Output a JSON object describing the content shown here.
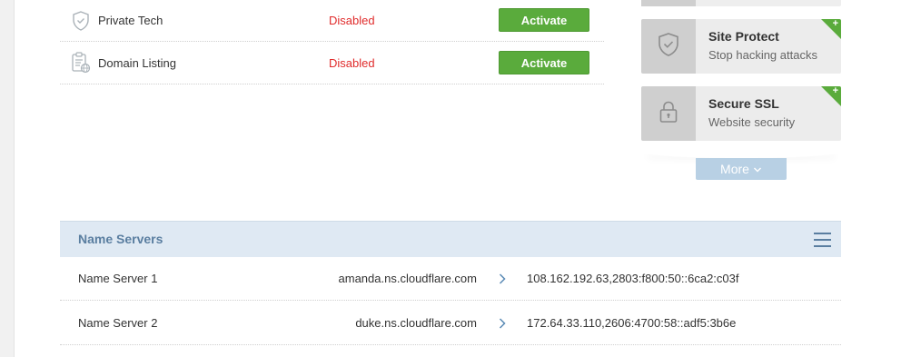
{
  "addons": [
    {
      "name": "Private Tech",
      "status": "Disabled",
      "action": "Activate",
      "icon": "shield-check-icon"
    },
    {
      "name": "Domain Listing",
      "status": "Disabled",
      "action": "Activate",
      "icon": "clipboard-globe-icon"
    }
  ],
  "promos": [
    {
      "title": "Site Protect",
      "subtitle": "Stop hacking attacks",
      "icon": "shield-check-icon",
      "corner": "+"
    },
    {
      "title": "Secure SSL",
      "subtitle": "Website security",
      "icon": "lock-icon",
      "corner": "+"
    }
  ],
  "more_label": "More",
  "nameservers": {
    "title": "Name Servers",
    "rows": [
      {
        "label": "Name Server 1",
        "host": "amanda.ns.cloudflare.com",
        "ip": "108.162.192.63,2803:f800:50::6ca2:c03f"
      },
      {
        "label": "Name Server 2",
        "host": "duke.ns.cloudflare.com",
        "ip": "172.64.33.110,2606:4700:58::adf5:3b6e"
      }
    ]
  },
  "colors": {
    "accent_green": "#5aab3c",
    "status_red": "#e02b2b",
    "panel_blue": "#dfe9f3",
    "header_text": "#5a7ea0"
  }
}
